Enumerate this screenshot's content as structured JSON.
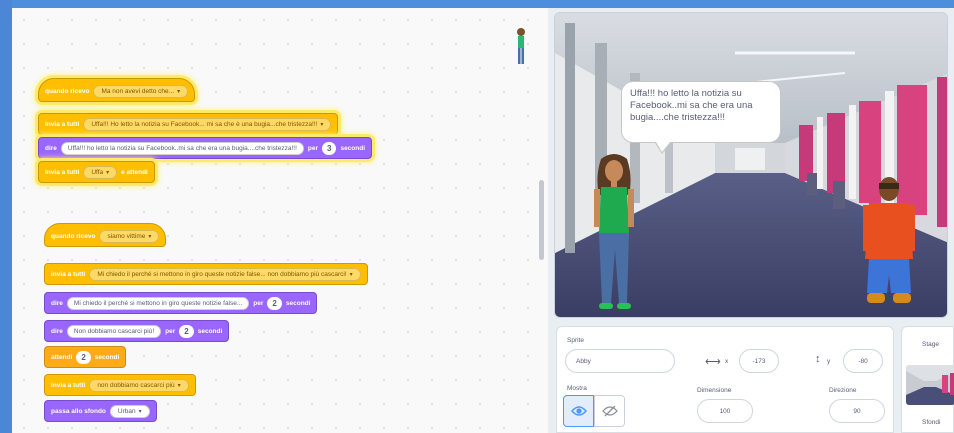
{
  "script1": {
    "hat_kw": "quando ricevo",
    "hat_msg": "Ma non avevi detto che...",
    "b2_kw": "invia a tutti",
    "b2_msg": "Uffa!!! Ho letto la notizia su Facebook... mi sa che è una bugia...che tristezza!!!",
    "b3_kw": "dire",
    "b3_text": "Uffa!!! ho letto la notizia su Facebook..mi sa che era una bugia....che tristezza!!!",
    "b3_per": "per",
    "b3_num": "3",
    "b3_unit": "secondi",
    "b4_kw": "invia a tutti",
    "b4_msg": "Uffa",
    "b4_tail": "e attendi"
  },
  "script2": {
    "hat_kw": "quando ricevo",
    "hat_msg": "siamo vittime",
    "b2_kw": "invia a tutti",
    "b2_msg": "Mi chiedo il perché si mettono in giro queste notizie false... non dobbiamo più cascarci!",
    "b3_kw": "dire",
    "b3_text": "Mi chiedo il perché si mettono in giro queste notizie false...",
    "b3_per": "per",
    "b3_num": "2",
    "b3_unit": "secondi",
    "b4_kw": "dire",
    "b4_text": "Non dobbiamo cascarci più!",
    "b4_per": "per",
    "b4_num": "2",
    "b4_unit": "secondi",
    "b5_kw": "attendi",
    "b5_num": "2",
    "b5_unit": "secondi",
    "b6_kw": "invia a tutti",
    "b6_msg": "non dobbiamo cascarci più",
    "b7_kw": "passa allo sfondo",
    "b7_msg": "Urban"
  },
  "stage": {
    "speech": "Uffa!!! ho letto la notizia su Facebook..mi sa che era una bugia....che tristezza!!!"
  },
  "sprite_info": {
    "sprite_label": "Sprite",
    "sprite_name": "Abby",
    "x_label": "x",
    "x_value": "-173",
    "y_label": "y",
    "y_value": "-80",
    "show_label": "Mostra",
    "size_label": "Dimensione",
    "size_value": "100",
    "direction_label": "Direzione",
    "direction_value": "90"
  },
  "stage_panel": {
    "title": "Stage",
    "backdrops_label": "Sfondi"
  },
  "colors": {
    "events": "#ffbf00",
    "looks": "#9966ff",
    "control": "#ffab19",
    "accent": "#4c97ff"
  },
  "icons": [
    "dropdown-caret-icon",
    "eye-icon",
    "eye-hidden-icon",
    "x-arrows-icon",
    "y-arrows-icon"
  ]
}
